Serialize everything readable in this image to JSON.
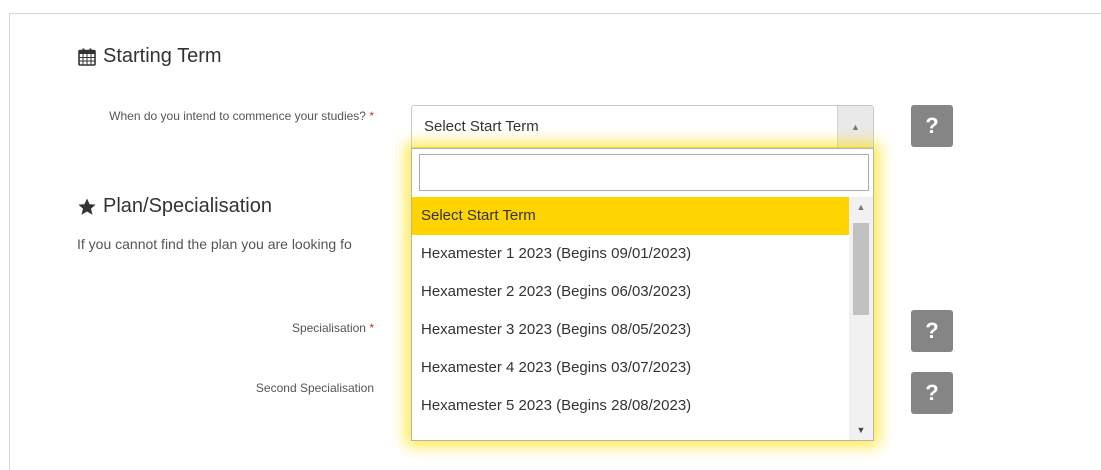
{
  "starting_term": {
    "heading": "Starting Term",
    "icon": "calendar-icon",
    "question": "When do you intend to commence your studies?",
    "required_marker": "*",
    "select_value": "Select Start Term",
    "help_label": "?"
  },
  "dropdown": {
    "search_value": "",
    "options": [
      "Select Start Term",
      "Hexamester 1 2023 (Begins 09/01/2023)",
      "Hexamester 2 2023 (Begins 06/03/2023)",
      "Hexamester 3 2023 (Begins 08/05/2023)",
      "Hexamester 4 2023 (Begins 03/07/2023)",
      "Hexamester 5 2023 (Begins 28/08/2023)"
    ],
    "selected_index": 0,
    "highlight_color": "#ffd400"
  },
  "plan": {
    "heading": "Plan/Specialisation",
    "icon": "star-icon",
    "note": "If you cannot find the plan you are looking fo",
    "specialisation_label": "Specialisation",
    "specialisation_required": "*",
    "second_specialisation_label": "Second Specialisation",
    "help_label": "?"
  },
  "colors": {
    "help_button": "#858585",
    "required": "#c9302c"
  }
}
